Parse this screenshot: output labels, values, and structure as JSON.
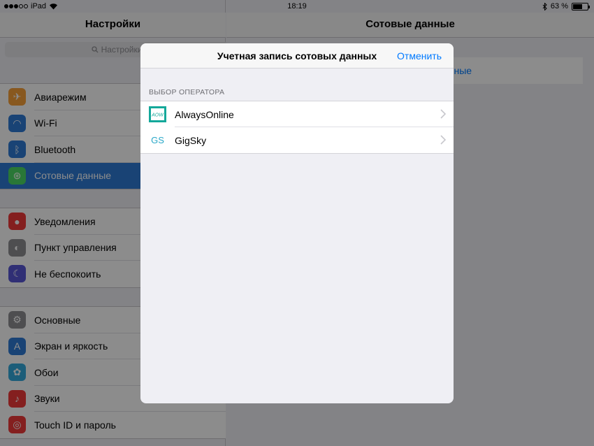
{
  "status_bar": {
    "carrier": "iPad",
    "time": "18:19",
    "battery_label": "63 %",
    "battery_level": 0.63
  },
  "left_panel": {
    "title": "Настройки",
    "search_placeholder": "Настройки",
    "groups": [
      [
        {
          "label": "Авиарежим",
          "icon": "airplane-icon",
          "color": "#f7a13a"
        },
        {
          "label": "Wi-Fi",
          "icon": "wifi-icon",
          "color": "#2f7bd6"
        },
        {
          "label": "Bluetooth",
          "icon": "bluetooth-icon",
          "color": "#2f7bd6"
        },
        {
          "label": "Сотовые данные",
          "icon": "cellular-icon",
          "color": "#4cd964",
          "selected": true
        }
      ],
      [
        {
          "label": "Уведомления",
          "icon": "notifications-icon",
          "color": "#f03a3a"
        },
        {
          "label": "Пункт управления",
          "icon": "control-center-icon",
          "color": "#8e8e93"
        },
        {
          "label": "Не беспокоить",
          "icon": "moon-icon",
          "color": "#5856d6"
        }
      ],
      [
        {
          "label": "Основные",
          "icon": "gear-icon",
          "color": "#8e8e93"
        },
        {
          "label": "Экран и яркость",
          "icon": "display-icon",
          "color": "#2f7bd6"
        },
        {
          "label": "Обои",
          "icon": "wallpaper-icon",
          "color": "#34aadc"
        },
        {
          "label": "Звуки",
          "icon": "sound-icon",
          "color": "#f03a3a"
        },
        {
          "label": "Touch ID и пароль",
          "icon": "fingerprint-icon",
          "color": "#f03a3a"
        }
      ]
    ]
  },
  "right_panel": {
    "title": "Сотовые данные",
    "row_label": "анные"
  },
  "modal": {
    "title": "Учетная запись сотовых данных",
    "cancel_label": "Отменить",
    "section_header": "ВЫБОР ОПЕРАТОРА",
    "operators": [
      {
        "name": "AlwaysOnline",
        "logo": "alwaysonline-logo-icon",
        "logo_text": "AOW",
        "color": "#14a89a"
      },
      {
        "name": "GigSky",
        "logo": "gigsky-logo-icon",
        "logo_text": "GS",
        "color": "#2aa8c8"
      }
    ]
  }
}
